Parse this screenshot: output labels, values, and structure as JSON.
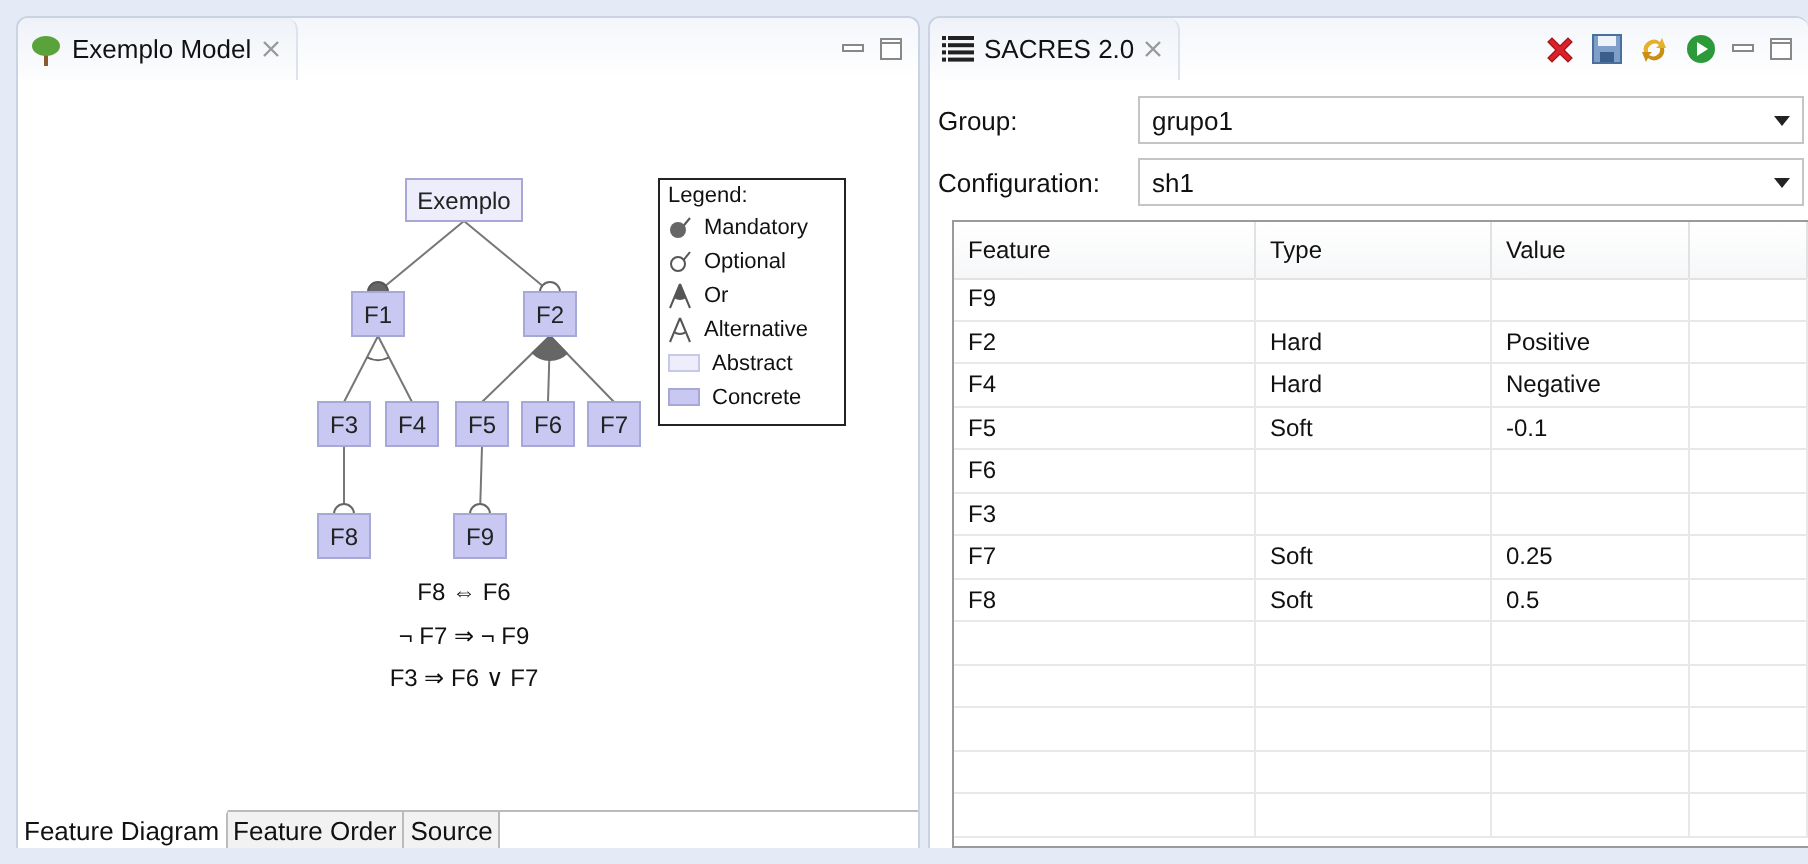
{
  "left_panel": {
    "tab": {
      "title": "Exemplo Model"
    },
    "diagram": {
      "root": {
        "name": "Exemplo",
        "kind": "abstract",
        "children": [
          {
            "name": "F1",
            "kind": "concrete",
            "optional": false,
            "alternative": true,
            "children": [
              {
                "name": "F3",
                "kind": "concrete",
                "children": [
                  {
                    "name": "F8",
                    "kind": "concrete",
                    "optional": true
                  }
                ]
              },
              {
                "name": "F4",
                "kind": "concrete"
              }
            ]
          },
          {
            "name": "F2",
            "kind": "concrete",
            "optional": true,
            "alternative": false,
            "children": [
              {
                "name": "F5",
                "kind": "concrete",
                "children": [
                  {
                    "name": "F9",
                    "kind": "concrete",
                    "optional": true
                  }
                ]
              },
              {
                "name": "F6",
                "kind": "concrete"
              },
              {
                "name": "F7",
                "kind": "concrete"
              }
            ]
          }
        ]
      },
      "legend": {
        "title": "Legend:",
        "items": [
          {
            "kind": "mandatory",
            "label": "Mandatory"
          },
          {
            "kind": "optional",
            "label": "Optional"
          },
          {
            "kind": "or",
            "label": "Or"
          },
          {
            "kind": "alternative",
            "label": "Alternative"
          },
          {
            "kind": "abstract",
            "label": "Abstract"
          },
          {
            "kind": "concrete",
            "label": "Concrete"
          }
        ]
      },
      "constraints": [
        "F8 ⇔ F6",
        "¬ F7 ⇒ ¬ F9",
        "F3 ⇒ F6 ∨ F7"
      ]
    },
    "bottom_tabs": [
      {
        "label": "Feature Diagram",
        "selected": true
      },
      {
        "label": "Feature Order",
        "selected": false
      },
      {
        "label": "Source",
        "selected": false
      }
    ]
  },
  "right_panel": {
    "tab": {
      "title": "SACRES 2.0"
    },
    "group": {
      "label": "Group:",
      "value": "grupo1"
    },
    "configuration": {
      "label": "Configuration:",
      "value": "sh1"
    },
    "table": {
      "columns": [
        "Feature",
        "Type",
        "Value"
      ],
      "rows": [
        {
          "feature": "F9"
        },
        {
          "feature": "F2",
          "type": "Hard",
          "value": "Positive"
        },
        {
          "feature": "F4",
          "type": "Hard",
          "value": "Negative"
        },
        {
          "feature": "F5",
          "type": "Soft",
          "value": "-0.1"
        },
        {
          "feature": "F6"
        },
        {
          "feature": "F3"
        },
        {
          "feature": "F7",
          "type": "Soft",
          "value": "0.25"
        },
        {
          "feature": "F8",
          "type": "Soft",
          "value": "0.5"
        }
      ]
    }
  }
}
